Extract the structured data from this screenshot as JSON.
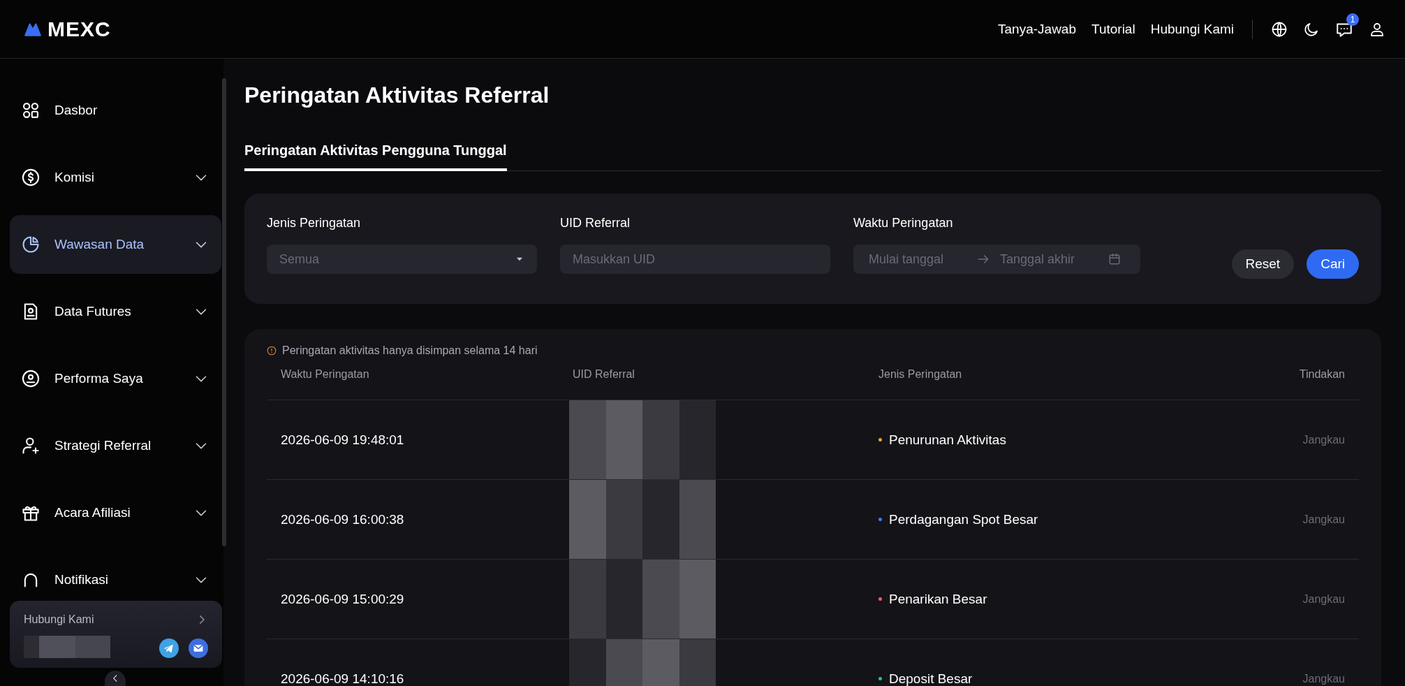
{
  "header": {
    "logo": "MEXC",
    "nav": [
      "Tanya-Jawab",
      "Tutorial",
      "Hubungi Kami"
    ],
    "message_badge": "1"
  },
  "sidebar": {
    "items": [
      {
        "label": "Dasbor",
        "expandable": false,
        "selected": false
      },
      {
        "label": "Komisi",
        "expandable": true,
        "selected": false
      },
      {
        "label": "Wawasan Data",
        "expandable": true,
        "selected": true
      },
      {
        "label": "Data Futures",
        "expandable": true,
        "selected": false
      },
      {
        "label": "Performa Saya",
        "expandable": true,
        "selected": false
      },
      {
        "label": "Strategi Referral",
        "expandable": true,
        "selected": false
      },
      {
        "label": "Acara Afiliasi",
        "expandable": true,
        "selected": false
      },
      {
        "label": "Notifikasi",
        "expandable": true,
        "selected": false
      }
    ],
    "contact": {
      "title": "Hubungi Kami"
    }
  },
  "page": {
    "title": "Peringatan Aktivitas Referral",
    "tabs": [
      {
        "label": "Peringatan Aktivitas Pengguna Tunggal",
        "selected": true
      }
    ]
  },
  "filters": {
    "alert_type": {
      "label": "Jenis Peringatan",
      "value": "Semua"
    },
    "uid": {
      "label": "UID Referral",
      "placeholder": "Masukkan UID"
    },
    "time": {
      "label": "Waktu Peringatan",
      "start_placeholder": "Mulai tanggal",
      "end_placeholder": "Tanggal akhir"
    },
    "buttons": [
      "Reset",
      "Cari"
    ]
  },
  "table": {
    "notice": "Peringatan aktivitas hanya disimpan selama 14 hari",
    "columns": [
      "Waktu Peringatan",
      "UID Referral",
      "Jenis Peringatan",
      "Tindakan"
    ],
    "rows": [
      {
        "time": "2026-06-09 19:48:01",
        "type": "Penurunan Aktivitas",
        "color": "#e8a13a",
        "action": "Jangkau"
      },
      {
        "time": "2026-06-09 16:00:38",
        "type": "Perdagangan Spot Besar",
        "color": "#3d7ff2",
        "action": "Jangkau"
      },
      {
        "time": "2026-06-09 15:00:29",
        "type": "Penarikan Besar",
        "color": "#ef5b6b",
        "action": "Jangkau"
      },
      {
        "time": "2026-06-09 14:10:16",
        "type": "Deposit Besar",
        "color": "#2fbf7a",
        "action": "Jangkau"
      }
    ]
  }
}
